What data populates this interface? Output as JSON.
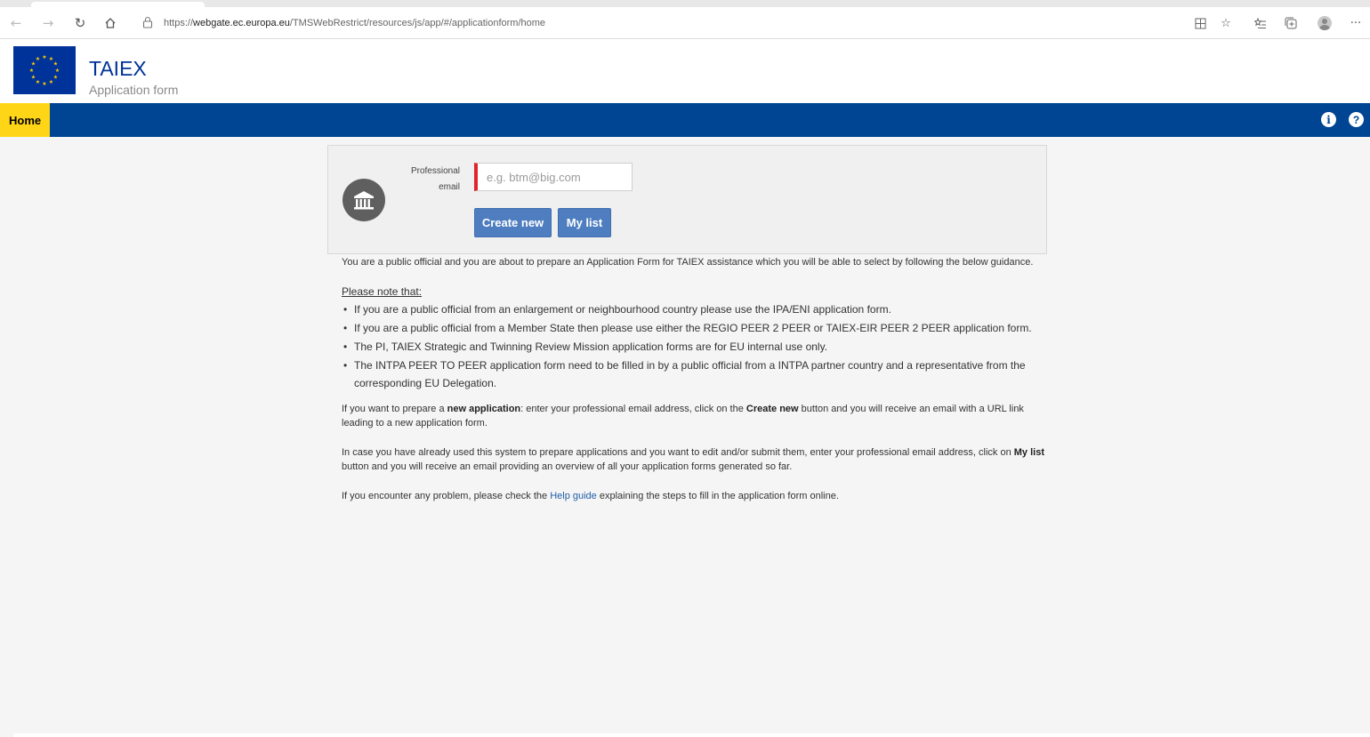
{
  "browser": {
    "url_prefix": "https://",
    "url_domain": "webgate.ec.europa.eu",
    "url_path": "/TMSWebRestrict/resources/js/app/#/applicationform/home",
    "icons": [
      "back-icon",
      "forward-icon",
      "refresh-icon",
      "home-icon",
      "lock-icon",
      "split-screen-icon",
      "add-favorite-icon",
      "favorites-icon",
      "collections-icon",
      "profile-icon",
      "more-icon"
    ]
  },
  "header": {
    "title": "TAIEX",
    "subtitle": "Application form",
    "brand_color": "#003399"
  },
  "navbar": {
    "home_label": "Home",
    "bar_color": "#004494",
    "active_color": "#ffd617"
  },
  "form": {
    "email_label": "Professional email",
    "email_placeholder": "e.g. btm@big.com",
    "email_value": "",
    "create_label": "Create new",
    "mylist_label": "My list"
  },
  "guidance": {
    "intro": "You are a public official and you are about to prepare an Application Form for TAIEX assistance which you will be able to select by following the below guidance.",
    "note_title": "Please note that:",
    "notes": [
      "If you are a public official from an enlargement or neighbourhood country please use the IPA/ENI application form.",
      "If you are a public official from a Member State then please use either the REGIO PEER 2 PEER or TAIEX-EIR PEER 2 PEER application form.",
      "The PI, TAIEX Strategic and Twinning Review Mission application forms are for EU internal use only.",
      "The INTPA PEER TO PEER application form need to be filled in by a public official from a INTPA partner country and a representative from the corresponding EU Delegation."
    ],
    "p1_a": "If you want to prepare a ",
    "p1_b": "new application",
    "p1_c": ": enter your professional email address, click on the ",
    "p1_d": "Create new",
    "p1_e": " button and you will receive an email with a URL link leading to a new application form.",
    "p2_a": "In case you have already used this system to prepare applications and you want to edit and/or submit them, enter your professional email address, click on ",
    "p2_b": "My list",
    "p2_c": " button and you will receive an email providing an overview of all your application forms generated so far.",
    "p3_a": "If you encounter any problem, please check the ",
    "p3_link": "Help guide",
    "p3_b": " explaining the steps to fill in the application form online."
  }
}
